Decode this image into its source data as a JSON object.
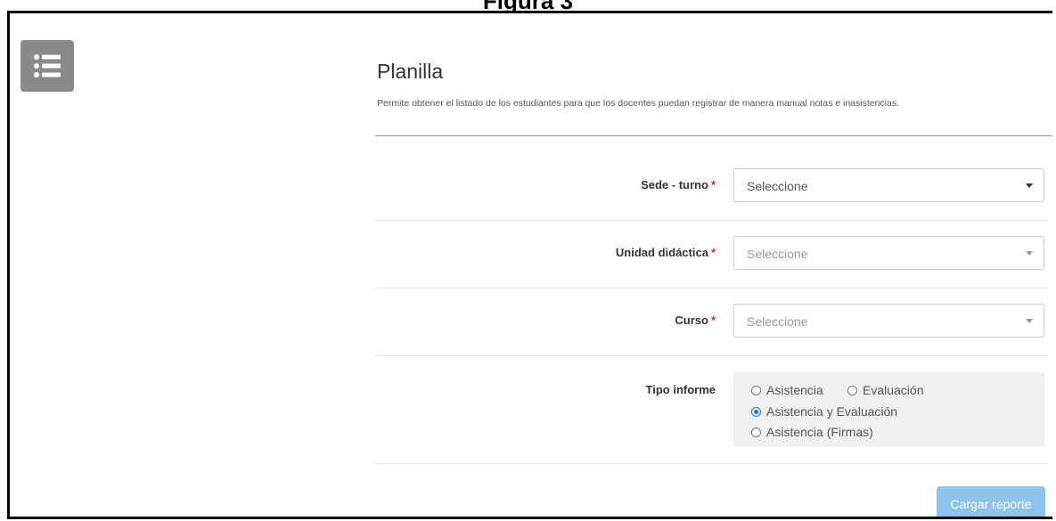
{
  "caption": "Figura 3",
  "menu": {
    "icon": "list-icon"
  },
  "page": {
    "title": "Planilla",
    "description": "Permite obtener el listado de los estudiantes para que los docentes puedan registrar de manera manual notas e inasistencias."
  },
  "form": {
    "required_mark": "*",
    "sede_turno": {
      "label": "Sede - turno",
      "value": "Seleccione"
    },
    "unidad_didactica": {
      "label": "Unidad didáctica",
      "value": "Seleccione"
    },
    "curso": {
      "label": "Curso",
      "value": "Seleccione"
    },
    "tipo_informe": {
      "label": "Tipo informe",
      "options": [
        "Asistencia",
        "Evaluación",
        "Asistencia y Evaluación",
        "Asistencia (Firmas)"
      ],
      "selected": "Asistencia y Evaluación"
    },
    "submit_label": "Cargar reporte"
  },
  "colors": {
    "accent": "#1a73e8",
    "button": "#8ec3ec",
    "required": "#c0392b"
  }
}
